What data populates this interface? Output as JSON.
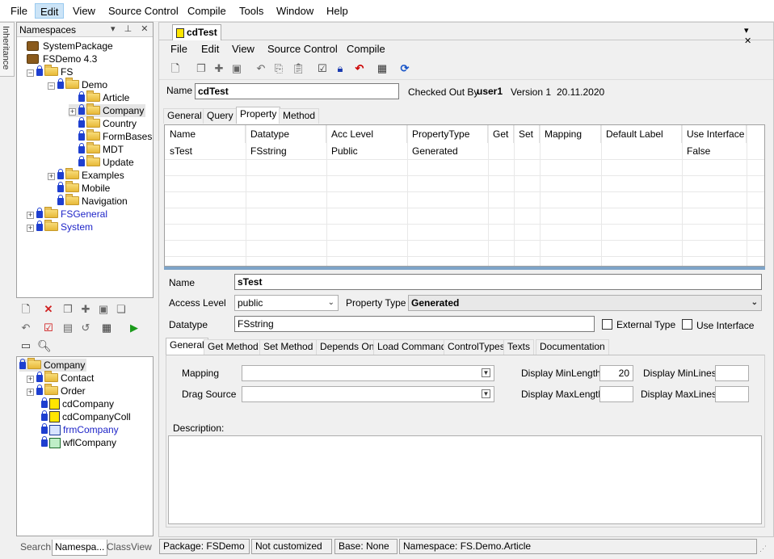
{
  "menu": [
    "File",
    "Edit",
    "View",
    "Source Control",
    "Compile",
    "Tools",
    "Window",
    "Help"
  ],
  "side_tab": "Inheritance",
  "namespaces": {
    "title": "Namespaces",
    "pin": "▾ ⊥ ✕",
    "items": [
      {
        "label": "SystemPackage"
      },
      {
        "label": "FSDemo 4.3"
      },
      {
        "label": "FS"
      },
      {
        "label": "Demo"
      },
      {
        "label": "Article"
      },
      {
        "label": "Company"
      },
      {
        "label": "Country"
      },
      {
        "label": "FormBases"
      },
      {
        "label": "MDT"
      },
      {
        "label": "Update"
      },
      {
        "label": "Examples"
      },
      {
        "label": "Mobile"
      },
      {
        "label": "Navigation"
      },
      {
        "label": "FSGeneral"
      },
      {
        "label": "System"
      }
    ]
  },
  "class_tree": {
    "items": [
      {
        "label": "Company"
      },
      {
        "label": "Contact"
      },
      {
        "label": "Order"
      },
      {
        "label": "cdCompany"
      },
      {
        "label": "cdCompanyColl"
      },
      {
        "label": "frmCompany"
      },
      {
        "label": "wflCompany"
      }
    ]
  },
  "bottom_tabs": [
    "Search",
    "Namespa...",
    "ClassView"
  ],
  "doc_tab": {
    "title": "cdTest",
    "controls": "▾ ✕"
  },
  "doc_menu": [
    "File",
    "Edit",
    "View",
    "Source Control",
    "Compile"
  ],
  "header": {
    "name_label": "Name",
    "name_value": "cdTest",
    "checked_out_label": "Checked Out By",
    "checked_out_user": "user1",
    "version": "Version 1",
    "date": "20.11.2020"
  },
  "top_tabs": [
    "General",
    "Query",
    "Property",
    "Method"
  ],
  "grid": {
    "columns": [
      "Name",
      "Datatype",
      "Acc Level",
      "PropertyType",
      "Get",
      "Set",
      "Mapping",
      "Default Label",
      "Use Interface"
    ],
    "rows": [
      [
        "sTest",
        "FSstring",
        "Public",
        "Generated",
        "",
        "",
        "",
        "",
        "False"
      ]
    ]
  },
  "detail": {
    "name_label": "Name",
    "name_value": "sTest",
    "access_label": "Access Level",
    "access_value": "public",
    "ptype_label": "Property Type",
    "ptype_value": "Generated",
    "datatype_label": "Datatype",
    "datatype_value": "FSstring",
    "external_type": "External Type",
    "use_interface": "Use Interface"
  },
  "detail_tabs": [
    "General",
    "Get Method",
    "Set Method",
    "Depends On",
    "Load Command",
    "ControlTypes",
    "Texts",
    "Documentation"
  ],
  "general": {
    "mapping_label": "Mapping",
    "drag_label": "Drag Source",
    "min_length_label": "Display MinLength",
    "min_length_value": "20",
    "max_length_label": "Display MaxLength",
    "max_length_value": "",
    "min_lines_label": "Display MinLines",
    "max_lines_label": "Display MaxLines",
    "description_label": "Description:"
  },
  "status": [
    "Package: FSDemo",
    "Not customized",
    "Base: None",
    "Namespace: FS.Demo.Article"
  ],
  "colors": {
    "selection": "#cce4f7",
    "link": "#1f25c8"
  }
}
